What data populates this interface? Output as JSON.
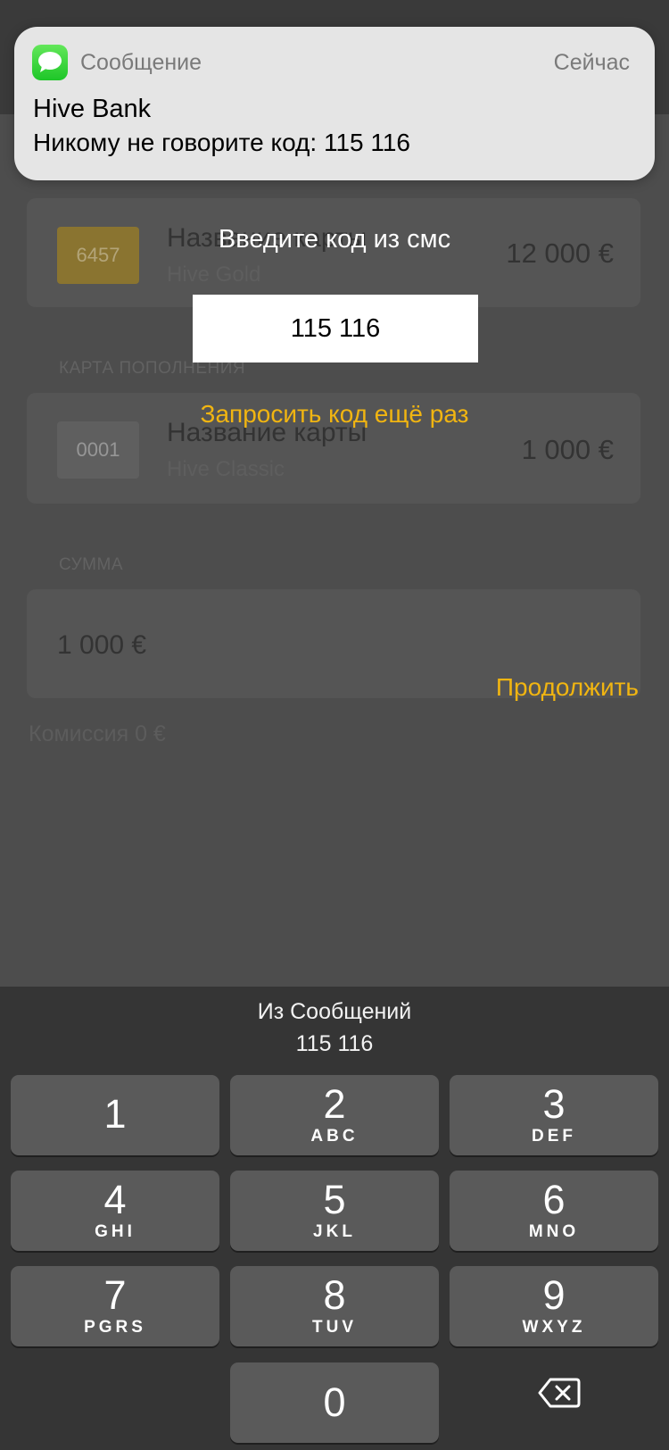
{
  "notification": {
    "app": "Сообщение",
    "time": "Сейчас",
    "sender": "Hive Bank",
    "body": "Никому не говорите код: 115 116",
    "icon": "messages-icon"
  },
  "background": {
    "card_from": {
      "chip": "6457",
      "title": "Название карты",
      "subtitle": "Hive Gold",
      "amount": "12 000 €",
      "chip_color": "#8a7430"
    },
    "topup_section": "КАРТА ПОПОЛНЕНИЯ",
    "card_to": {
      "chip": "0001",
      "title": "Название карты",
      "subtitle": "Hive Classic",
      "amount": "1 000 €",
      "chip_color": "#5f5f5f"
    },
    "sum_section": "СУММА",
    "sum_value": "1 000 €",
    "commission": "Комиссия 0 €"
  },
  "dialog": {
    "title": "Введите код из смс",
    "code_value": "115 116",
    "resend_label": "Запросить код ещё раз",
    "continue_label": "Продолжить",
    "accent_color": "#f1b511"
  },
  "keyboard": {
    "suggestion_source": "Из Сообщений",
    "suggestion_code": "115 116",
    "keys": [
      {
        "num": "1",
        "letters": ""
      },
      {
        "num": "2",
        "letters": "ABC"
      },
      {
        "num": "3",
        "letters": "DEF"
      },
      {
        "num": "4",
        "letters": "GHI"
      },
      {
        "num": "5",
        "letters": "JKL"
      },
      {
        "num": "6",
        "letters": "MNO"
      },
      {
        "num": "7",
        "letters": "PGRS"
      },
      {
        "num": "8",
        "letters": "TUV"
      },
      {
        "num": "9",
        "letters": "WXYZ"
      },
      {
        "num": "0",
        "letters": ""
      }
    ],
    "backspace_icon": "backspace-icon"
  }
}
